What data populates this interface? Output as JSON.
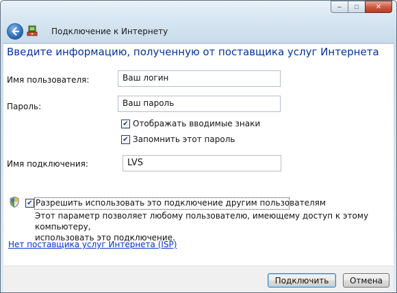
{
  "window": {
    "title": "Подключение к Интернету",
    "controls": {
      "minimize": "–",
      "maximize": "□",
      "close": "✕"
    }
  },
  "form": {
    "heading": "Введите информацию, полученную от поставщика услуг Интернета",
    "username": {
      "label": "Имя пользователя:",
      "value": "Ваш логин"
    },
    "password": {
      "label": "Пароль:",
      "value": "Ваш пароль"
    },
    "show_chars": {
      "label": "Отображать вводимые знаки",
      "checked": true
    },
    "remember_password": {
      "label": "Запомнить этот пароль",
      "checked": true
    },
    "connection_name": {
      "label": "Имя подключения:",
      "value": "LVS"
    },
    "allow_others": {
      "label": "Разрешить использовать это подключение другим пользователям",
      "checked": true,
      "description_line1": "Этот параметр позволяет любому пользователю, имеющему доступ к этому компьютеру,",
      "description_line2": "использовать это подключение."
    },
    "no_isp_link": "Нет поставщика услуг Интернета (ISP)"
  },
  "buttons": {
    "connect": "Подключить",
    "cancel": "Отмена"
  },
  "colors": {
    "heading": "#003399",
    "link": "#0033cc",
    "accent": "#3c7fb1"
  }
}
